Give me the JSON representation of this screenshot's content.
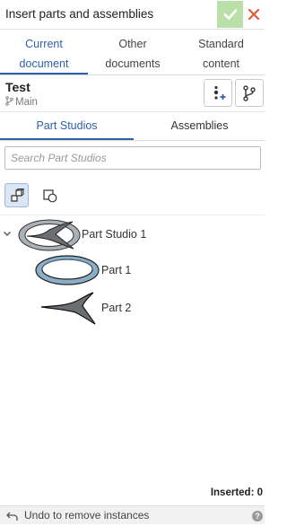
{
  "dialog": {
    "title": "Insert parts and assemblies",
    "confirm_icon": "checkmark-icon",
    "close_icon": "close-icon",
    "accent_confirm": "#b8e0a8",
    "accent_close": "#e05a3a"
  },
  "document_tabs": [
    {
      "line1": "Current",
      "line2": "document",
      "active": true
    },
    {
      "line1": "Other",
      "line2": "documents",
      "active": false
    },
    {
      "line1": "Standard",
      "line2": "content",
      "active": false
    }
  ],
  "document": {
    "name": "Test",
    "branch": "Main",
    "branch_icon": "branch-icon"
  },
  "toolbar": {
    "insert_with_options_icon": "insert-options-icon",
    "branch_version_icon": "version-graph-icon"
  },
  "content_tabs": [
    {
      "label": "Part Studios",
      "active": true
    },
    {
      "label": "Assemblies",
      "active": false
    }
  ],
  "search": {
    "placeholder": "Search Part Studios",
    "value": ""
  },
  "view_toggles": [
    {
      "icon": "parts-view-icon",
      "active": true
    },
    {
      "icon": "shapes-view-icon",
      "active": false
    }
  ],
  "tree": {
    "studio": {
      "label": "Part Studio 1",
      "expanded": true
    },
    "parts": [
      {
        "label": "Part 1"
      },
      {
        "label": "Part 2"
      }
    ]
  },
  "footer": {
    "inserted_text": "Inserted: 0",
    "undo_label": "Undo to remove instances",
    "help_icon": "help-icon"
  },
  "colors": {
    "accent": "#2f5fa8"
  }
}
